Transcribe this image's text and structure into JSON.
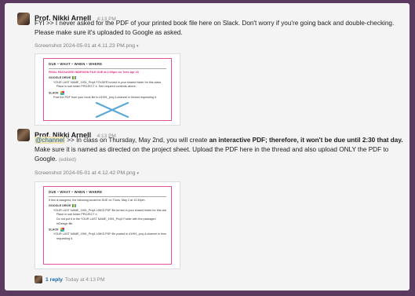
{
  "message1": {
    "author": "Prof. Nikki Arnell",
    "time": "4:13 PM",
    "text": "FYI >> I never asked for the PDF of your printed book file here on Slack. Don't worry if you're going back and double-checking. Please make sure it's uploaded to Google as asked.",
    "attachment_label": "Screenshot 2024-05-01 at 4.11.23 PM.png",
    "attachment_caret": "▾",
    "doc": {
      "title": "DUE • WHAT • WHEN • WHERE",
      "deadline": "FINAL PACKAGED INDESIGN FILE DUE at 2:00pm on Tues Apr 23",
      "gdrive_label": "GOOGLE DRIVE",
      "gdrive_item1": "YOUR LAST NAME_1991_Proj4 FOLDER turned in your shared folder for this class.",
      "gdrive_item2": "Place in sub folder PROJECT 4. See required contents above.",
      "slack_label": "SLACK",
      "slack_item": "Post the PDF from your book file to #1991_proj-4-channel in thread requesting it."
    }
  },
  "message2": {
    "author": "Prof. Nikki Arnell",
    "time": "4:13 PM",
    "mention": "@channel",
    "text_a": " >> In class on Thursday, May 2nd, you will create ",
    "text_bold": "an interactive PDF; therefore, it won't be due until 2:30 that day.",
    "text_b": " Make sure it is named as directed on the project sheet. Upload the PDF here in the thread and also upload ONLY the PDF to Google.",
    "edited": "(edited)",
    "attachment_label": "Screenshot 2024-05-01 at 4.12.42 PM.png",
    "attachment_caret": "▾",
    "doc": {
      "title": "DUE • WHAT • WHEN • WHERE",
      "intro": "If this is assigned, the following would be DUE on Thurs, May 2 at 12:30pm.",
      "gdrive_label": "GOOGLE DRIVE",
      "gdrive_item1": "YOUR LAST NAME_1991_Proj4 LINKS.PDF file turned in your shared folder for this class.",
      "gdrive_item2": "Place in sub folder PROJECT 4.",
      "gdrive_item3": "Do not put it in the YOUR LAST NAME_1991_Proj4 Folder with the packaged",
      "gdrive_item3b": "InDesign file.",
      "slack_label": "SLACK",
      "slack_item": "YOUR LAST NAME_1991_Proj4 LINKS.PDF file posted in #1991_proj-4-channel in thread",
      "slack_item_b": "requesting it."
    }
  },
  "thread": {
    "reply_count": "1 reply",
    "reply_time": "Today at 4:13 PM"
  }
}
